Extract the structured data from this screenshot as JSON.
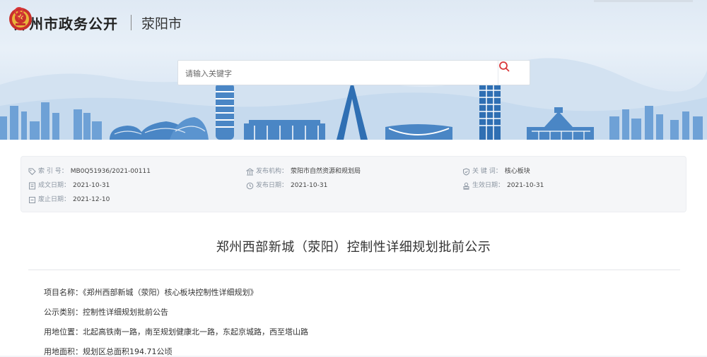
{
  "header": {
    "site_title": "郑州市政务公开",
    "city": "荥阳市",
    "emblem_icon": "national-emblem-icon",
    "location_icon": "location-pin-icon"
  },
  "search": {
    "placeholder": "请输入关键字",
    "button_icon": "search-icon"
  },
  "meta": {
    "index_label": "索 引 号：",
    "index_value": "MB0Q51936/2021-00111",
    "publisher_label": "发布机构：",
    "publisher_value": "荥阳市自然资源和规划局",
    "keyword_label": "关 键 词：",
    "keyword_value": "核心板块",
    "created_label": "成文日期：",
    "created_value": "2021-10-31",
    "published_label": "发布日期：",
    "published_value": "2021-10-31",
    "effective_label": "生效日期：",
    "effective_value": "2021-10-31",
    "abolished_label": "废止日期：",
    "abolished_value": "2021-12-10"
  },
  "document": {
    "title": "郑州西部新城（荥阳）控制性详细规划批前公示",
    "paragraphs": [
      "项目名称：《郑州西部新城（荥阳）核心板块控制性详细规划》",
      "公示类别：控制性详细规划批前公告",
      "用地位置：北起高铁南一路，南至规划健康北一路，东起京城路，西至塔山路",
      "用地面积：规划区总面积194.71公顷"
    ]
  },
  "colors": {
    "accent_red": "#d9383a",
    "sky": "#dfe9f4",
    "skyline": "#4a86c5"
  }
}
